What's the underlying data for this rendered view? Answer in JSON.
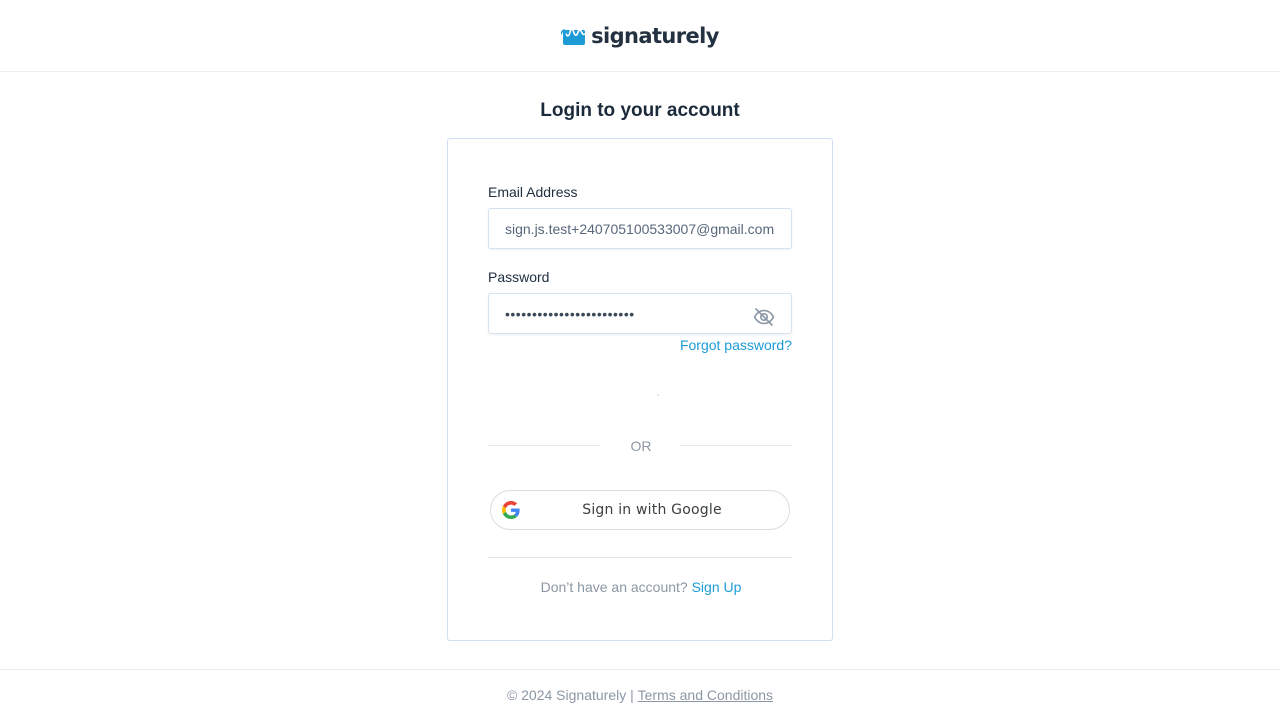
{
  "header": {
    "brand_name": "signaturely",
    "logo_icon": "signature-wave-icon",
    "brand_color": "#1d9bd7"
  },
  "main": {
    "title": "Login to your account"
  },
  "form": {
    "email_label": "Email Address",
    "email_value": "sign.js.test+240705100533007@gmail.com",
    "password_label": "Password",
    "password_value": "••••••••••••••••••••••••",
    "password_toggle_icon": "eye-slash-icon",
    "forgot_password": "Forgot password?",
    "or_text": "OR",
    "google_button": "Sign in with Google",
    "google_icon": "google-g-icon",
    "signup_prompt": "Don’t have an account?",
    "signup_link": "Sign Up"
  },
  "footer": {
    "copyright": "© 2024 Signaturely |",
    "terms_link": "Terms and Conditions"
  },
  "colors": {
    "link": "#1d9bd7",
    "text": "#1c2b3c",
    "muted": "#8b97a4",
    "card_border": "#cfe0f4"
  }
}
